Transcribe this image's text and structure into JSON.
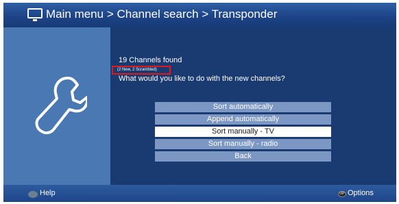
{
  "header": {
    "breadcrumb": "Main menu > Channel search > Transponder",
    "icon": "tv-icon"
  },
  "left_panel": {
    "icon": "wrench-icon"
  },
  "main": {
    "found_text": "19 Channels found",
    "detail_text": "(2 New, 2 Scrambled)",
    "question_text": "What would you like to do with the new channels?",
    "options": [
      {
        "label": "Sort automatically",
        "selected": false
      },
      {
        "label": "Append automatically",
        "selected": false
      },
      {
        "label": "Sort manually - TV",
        "selected": true
      },
      {
        "label": "Sort manually - radio",
        "selected": false
      },
      {
        "label": "Back",
        "selected": false
      }
    ]
  },
  "footer": {
    "help_label": "Help",
    "options_label": "Options",
    "options_icon_text": "OP"
  },
  "colors": {
    "background": "#1c3f78",
    "left_panel": "#4a78b2",
    "option_bg": "#7d97c4",
    "option_selected_bg": "#ffffff",
    "highlight_border": "#e01818"
  }
}
